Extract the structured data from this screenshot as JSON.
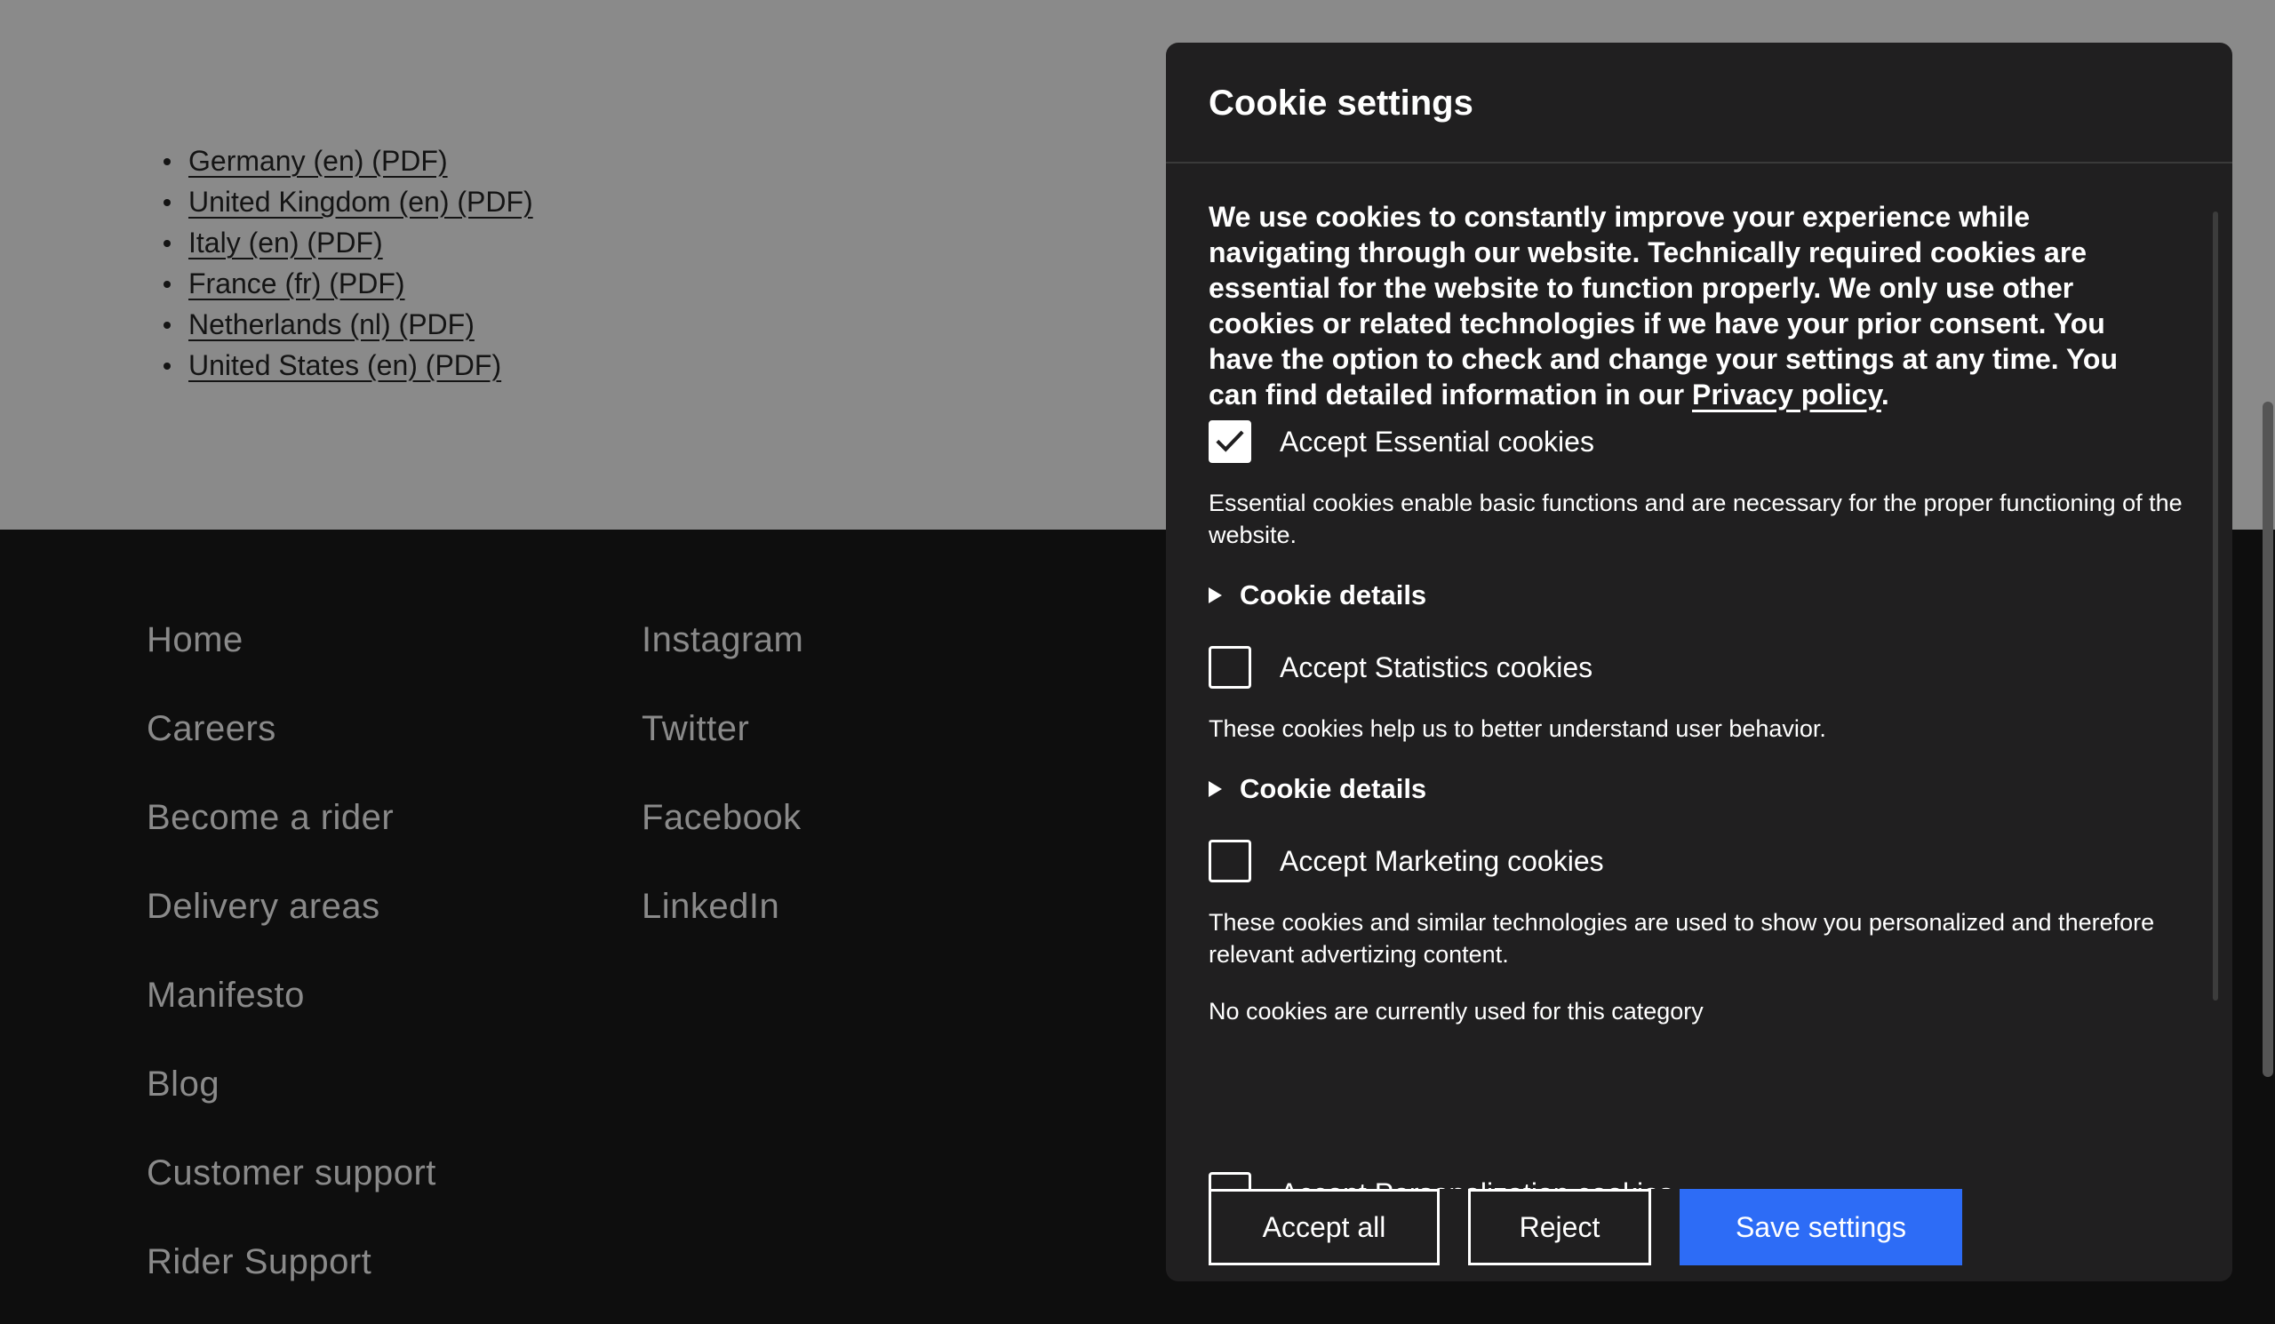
{
  "pdf_links": [
    "Germany (en) (PDF)",
    "United Kingdom (en) (PDF)",
    "Italy (en) (PDF)",
    "France (fr) (PDF)",
    "Netherlands (nl) (PDF)",
    "United States (en) (PDF)"
  ],
  "footer": {
    "col1": [
      "Home",
      "Careers",
      "Become a rider",
      "Delivery areas",
      "Manifesto",
      "Blog",
      "Customer support",
      "Rider Support"
    ],
    "col2": [
      "Instagram",
      "Twitter",
      "Facebook",
      "LinkedIn"
    ]
  },
  "dialog": {
    "title": "Cookie settings",
    "intro_text": "We use cookies to constantly improve your experience while navigating through our website. Technically required cookies are essential for the website to function properly. We only use other cookies or related technologies if we have your prior consent. You have the option to check and change your settings at any time. You can find detailed information in our ",
    "privacy_link": "Privacy policy",
    "intro_end": ".",
    "essential": {
      "label": "Accept Essential cookies",
      "checked": true,
      "description": "Essential cookies enable basic functions and are necessary for the proper functioning of the website.",
      "details": "Cookie details"
    },
    "statistics": {
      "label": "Accept Statistics cookies",
      "checked": false,
      "description": "These cookies help us to better understand user behavior.",
      "details": "Cookie details"
    },
    "marketing": {
      "label": "Accept Marketing cookies",
      "checked": false,
      "description": "These cookies and similar technologies are used to show you personalized and therefore relevant advertizing content.",
      "note": "No cookies are currently used for this category"
    },
    "personalization": {
      "label": "Accept Personalization cookies",
      "checked": false
    },
    "buttons": {
      "accept_all": "Accept all",
      "reject": "Reject",
      "save": "Save settings"
    }
  },
  "colors": {
    "page_top_bg": "#8a8a8a",
    "footer_bg": "#0e0e0e",
    "dialog_bg": "#201f20",
    "primary_button": "#2d6cf6"
  }
}
